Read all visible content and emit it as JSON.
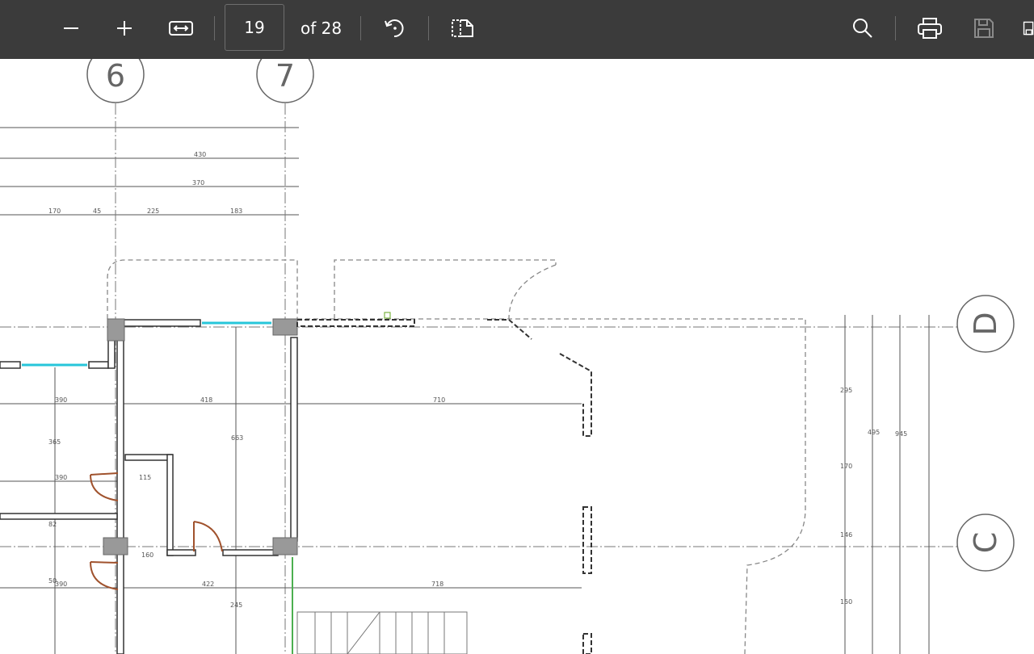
{
  "toolbar": {
    "zoom_out_icon": "minus-icon",
    "zoom_in_icon": "plus-icon",
    "fit_width_icon": "fit-width-icon",
    "current_page": "19",
    "total_pages_label": "of 28",
    "rotate_icon": "rotate-icon",
    "page_view_icon": "page-view-icon",
    "search_icon": "search-icon",
    "print_icon": "printer-icon",
    "save_icon": "save-icon",
    "save_as_icon": "save-as-icon"
  },
  "drawing": {
    "grid_labels": [
      "6",
      "7",
      "D",
      "C"
    ],
    "dimension_labels": [
      "430",
      "370",
      "170",
      "45",
      "225",
      "183",
      "390",
      "418",
      "710",
      "365",
      "390",
      "115",
      "663",
      "422",
      "718",
      "160",
      "245",
      "295",
      "495",
      "945",
      "170",
      "150",
      "146",
      "82",
      "50",
      "390"
    ]
  },
  "colors": {
    "toolbar_bg": "#3b3b3b",
    "icon": "#ffffff",
    "disabled_icon": "#8a8a8a",
    "window_glass": "#26c6da",
    "door": "#a0522d",
    "wall_green": "#4caf50"
  }
}
